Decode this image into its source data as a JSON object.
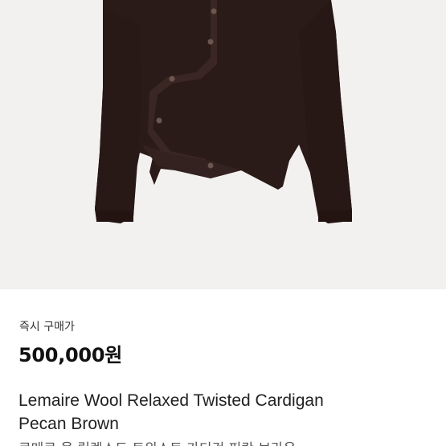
{
  "listing": {
    "price_label": "즉시 구매가",
    "price": "500,000원",
    "title_line1": "Lemaire Wool Relaxed Twisted Cardigan",
    "title_line2": "Pecan Brown",
    "subtitle": "르메르 울 릴렉스드 트위스트 가디건 피칸 브라운"
  },
  "colors": {
    "image_background": "#f3f1ef",
    "garment": "#2b1b18",
    "text_primary": "#111111"
  },
  "icons": {
    "product_photo": "cardigan-image"
  }
}
